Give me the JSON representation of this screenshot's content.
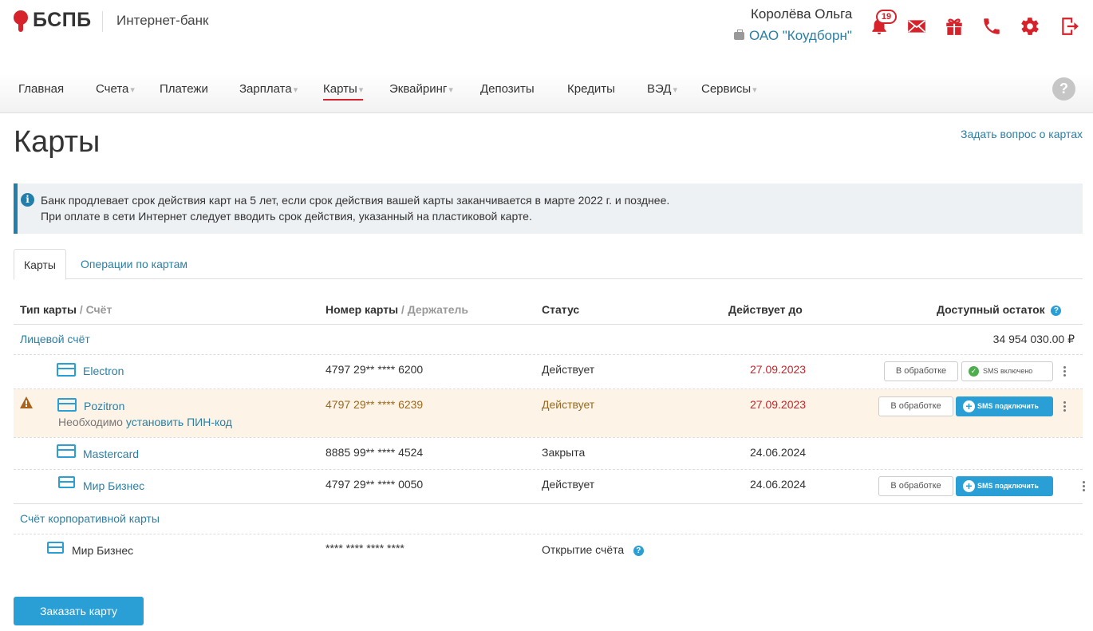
{
  "header": {
    "logo_text": "БСПБ",
    "app_title": "Интернет-банк",
    "user_name": "Королёва Ольга",
    "organization": "ОАО \"Коудборн\"",
    "notifications_count": "19",
    "brand_color": "#d6222a",
    "icons": [
      "bell-icon",
      "mail-icon",
      "gift-icon",
      "phone-icon",
      "gear-icon",
      "logout-icon"
    ]
  },
  "nav": {
    "items": [
      {
        "label": "Главная",
        "has_dropdown": false
      },
      {
        "label": "Счета",
        "has_dropdown": true
      },
      {
        "label": "Платежи",
        "has_dropdown": false
      },
      {
        "label": "Зарплата",
        "has_dropdown": true
      },
      {
        "label": "Карты",
        "has_dropdown": true,
        "active": true
      },
      {
        "label": "Эквайринг",
        "has_dropdown": true
      },
      {
        "label": "Депозиты",
        "has_dropdown": false
      },
      {
        "label": "Кредиты",
        "has_dropdown": false
      },
      {
        "label": "ВЭД",
        "has_dropdown": true
      },
      {
        "label": "Сервисы",
        "has_dropdown": true
      }
    ],
    "help": "?"
  },
  "page": {
    "title": "Карты",
    "ask_link": "Задать вопрос о картах"
  },
  "info": {
    "line1": "Банк продлевает срок действия карт на 5 лет, если срок действия вашей карты заканчивается в марте 2022 г. и позднее.",
    "line2": "При оплате в сети Интернет следует вводить срок действия, указанный на пластиковой карте."
  },
  "tabs": {
    "cards": "Карты",
    "operations": "Операции по картам"
  },
  "table": {
    "headers": {
      "type": "Тип карты",
      "type_sub": " / Счёт",
      "number": "Номер карты",
      "number_sub": " / Держатель",
      "status": "Статус",
      "valid_until": "Действует до",
      "balance": "Доступный остаток"
    },
    "group1": {
      "account": "Лицевой счёт",
      "balance": "34 954 030.00 ₽",
      "rows": [
        {
          "name": "Electron",
          "number": "4797 29** **** 6200",
          "status": "Действует",
          "valid": "27.09.2023",
          "btn1": "В обработке",
          "btn2": "SMS включено"
        },
        {
          "name": "Pozitron",
          "note_prefix": "Необходимо ",
          "note_link": "установить ПИН-код",
          "number": "4797 29** **** 6239",
          "status": "Действует",
          "valid": "27.09.2023",
          "btn1": "В обработке",
          "btn2": "SMS подключить"
        },
        {
          "name": "Mastercard",
          "number": "8885 99** **** 4524",
          "status": "Закрыта",
          "valid": "24.06.2024"
        },
        {
          "name": "Мир Бизнес",
          "number": "4797 29** **** 0050",
          "status": "Действует",
          "valid": "24.06.2024",
          "btn1": "В обработке",
          "btn2": "SMS подключить"
        }
      ]
    },
    "group2": {
      "account": "Счёт корпоративной карты",
      "rows": [
        {
          "name": "Мир Бизнес",
          "number": "**** **** **** ****",
          "status": "Открытие счёта"
        }
      ]
    }
  },
  "order_button": "Заказать карту"
}
